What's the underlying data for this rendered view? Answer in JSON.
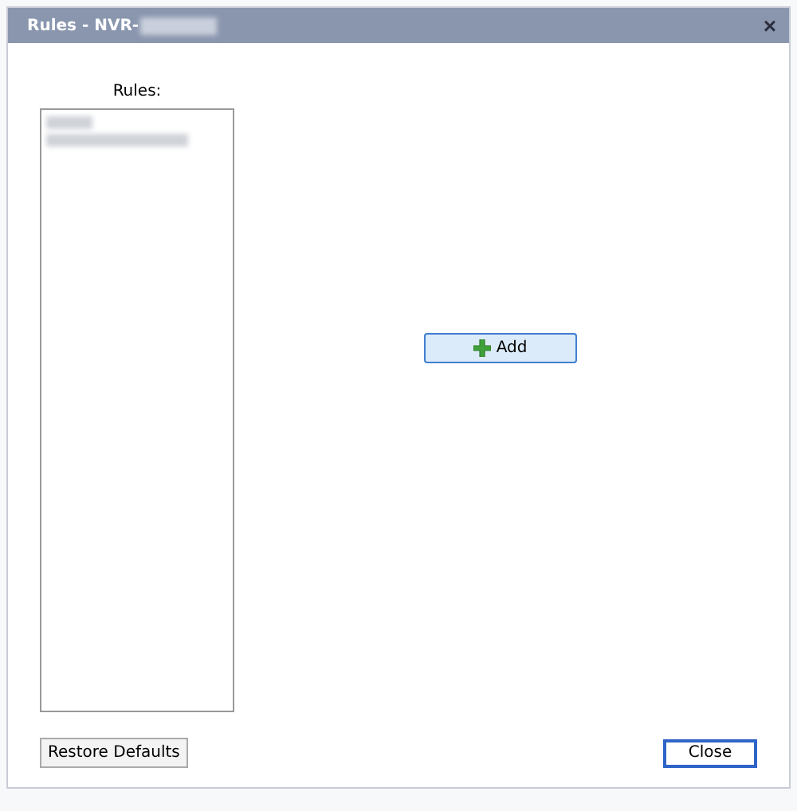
{
  "window": {
    "title": "Rules - NVR-",
    "title_redacted": true,
    "close": "×"
  },
  "rules_label": "Rules:",
  "rules": [
    {
      "kind": "redacted"
    },
    {
      "kind": "redacted"
    }
  ],
  "add_button": "Add",
  "buttons": [
    {
      "label": "Restore Defaults",
      "default": false
    },
    {
      "label": "Close",
      "default": true
    }
  ]
}
